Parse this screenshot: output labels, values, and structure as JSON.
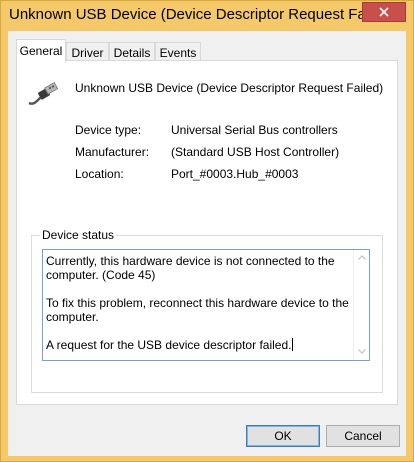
{
  "window": {
    "title": "Unknown USB Device (Device Descriptor Request Faile"
  },
  "tabs": [
    {
      "label": "General",
      "active": true
    },
    {
      "label": "Driver",
      "active": false
    },
    {
      "label": "Details",
      "active": false
    },
    {
      "label": "Events",
      "active": false
    }
  ],
  "device": {
    "name": "Unknown USB Device (Device Descriptor Request Failed)",
    "icon": "usb-cable-icon"
  },
  "properties": [
    {
      "label": "Device type:",
      "value": "Universal Serial Bus controllers"
    },
    {
      "label": "Manufacturer:",
      "value": "(Standard USB Host Controller)"
    },
    {
      "label": "Location:",
      "value": "Port_#0003.Hub_#0003"
    }
  ],
  "device_status": {
    "label": "Device status",
    "text": "Currently, this hardware device is not connected to the computer. (Code 45)\n\nTo fix this problem, reconnect this hardware device to the computer.\n\nA request for the USB device descriptor failed."
  },
  "buttons": {
    "ok": "OK",
    "cancel": "Cancel"
  },
  "colors": {
    "titlebar": "#f5c969",
    "close": "#c7504b",
    "focus_border": "#7a9fd4"
  }
}
